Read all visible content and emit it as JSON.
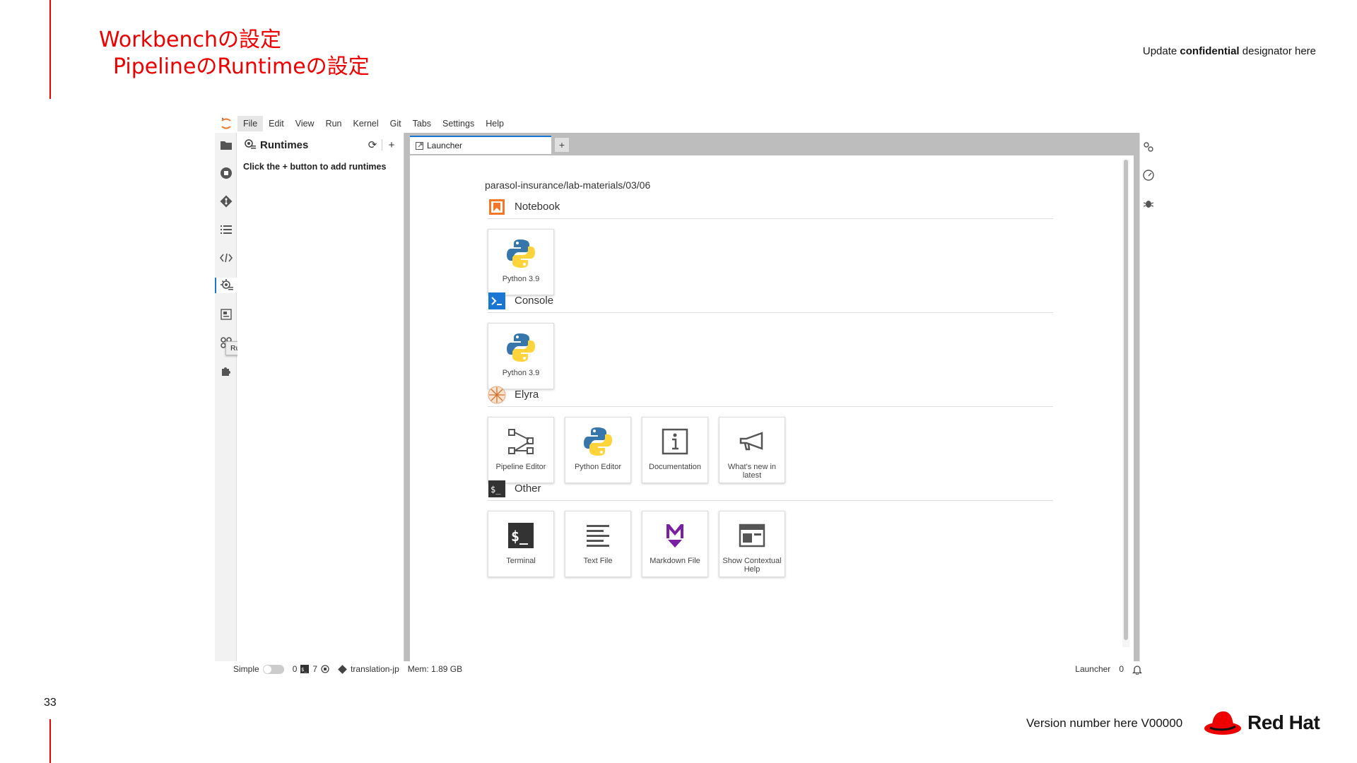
{
  "slide": {
    "title_line1": "Workbenchの設定",
    "title_line2": "PipelineのRuntimeの設定",
    "confidential_prefix": "Update ",
    "confidential_bold": "confidential",
    "confidential_suffix": " designator here",
    "page_number": "33",
    "version": "Version number here V00000",
    "brand": "Red Hat",
    "brand_color": "#ee0000"
  },
  "menubar": {
    "items": [
      "File",
      "Edit",
      "View",
      "Run",
      "Kernel",
      "Git",
      "Tabs",
      "Settings",
      "Help"
    ]
  },
  "left_bar": {
    "icons": [
      "folder-icon",
      "running-icon",
      "git-icon",
      "toc-icon",
      "code-snippet-icon",
      "runtimes-icon",
      "runtime-images-icon",
      "component-catalog-icon",
      "extension-icon"
    ],
    "tooltip": "Runtimes"
  },
  "side_panel": {
    "title": "Runtimes",
    "hint": "Click the + button to add runtimes",
    "refresh_glyph": "⟳",
    "add_glyph": "+"
  },
  "tabs": {
    "active_label": "Launcher",
    "add_glyph": "+"
  },
  "launcher": {
    "cwd": "parasol-insurance/lab-materials/03/06",
    "sections": {
      "notebook": {
        "label": "Notebook",
        "cards": [
          "Python 3.9"
        ]
      },
      "console": {
        "label": "Console",
        "cards": [
          "Python 3.9"
        ]
      },
      "elyra": {
        "label": "Elyra",
        "cards": [
          "Pipeline Editor",
          "Python Editor",
          "Documentation",
          "What's new in latest"
        ]
      },
      "other": {
        "label": "Other",
        "cards": [
          "Terminal",
          "Text File",
          "Markdown File",
          "Show Contextual Help"
        ]
      }
    }
  },
  "statusbar": {
    "mode": "Simple",
    "kernels": "0",
    "terminals": "7",
    "branch": "translation-jp",
    "memory": "Mem: 1.89 GB",
    "active_doc": "Launcher",
    "notifications": "0"
  }
}
